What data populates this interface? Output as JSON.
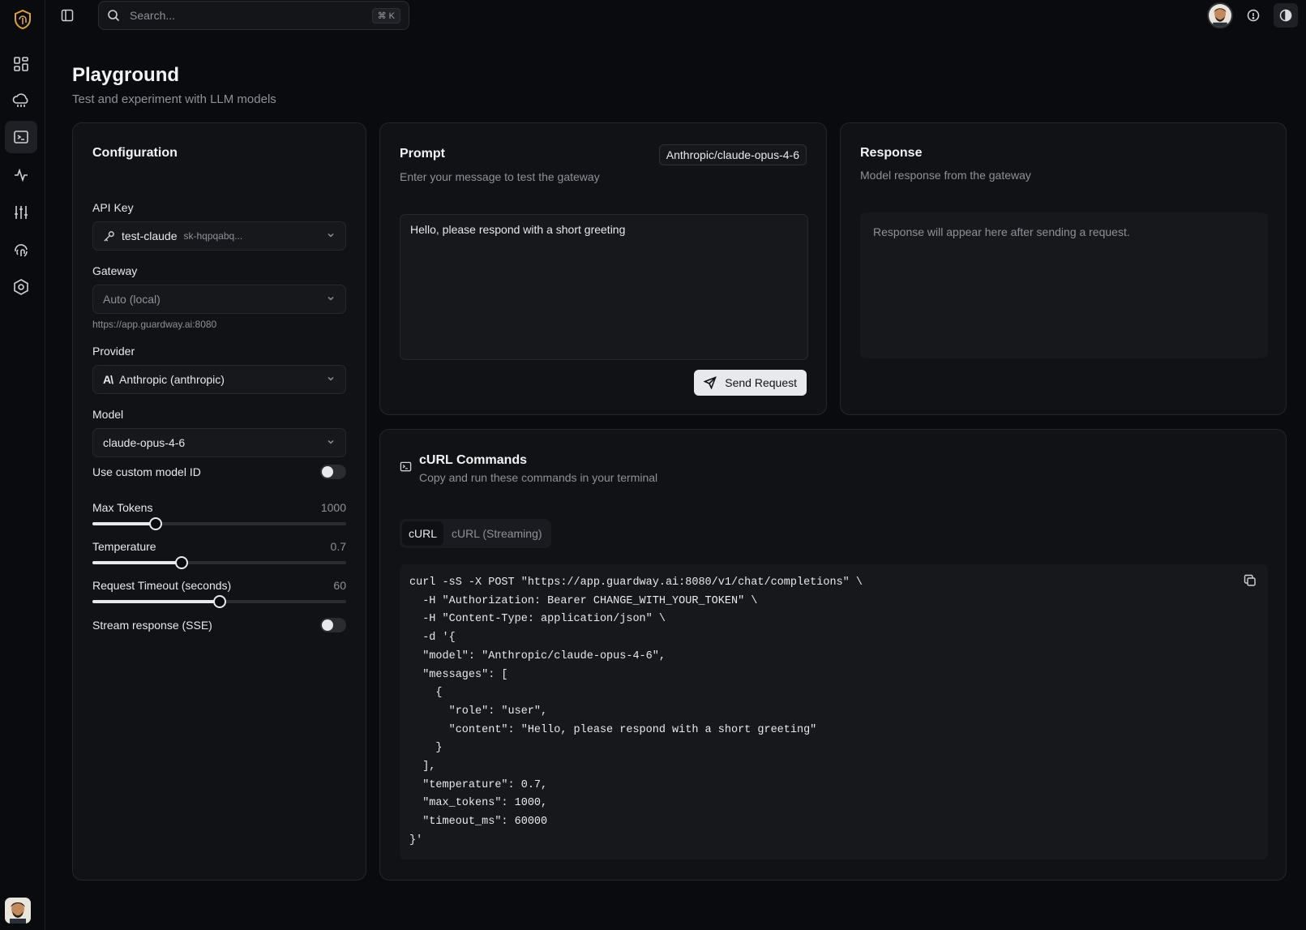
{
  "search": {
    "placeholder": "Search...",
    "shortcut": "⌘ K"
  },
  "nav": {
    "items": [
      {
        "name": "dashboard-icon",
        "active": false
      },
      {
        "name": "cloud-icon",
        "active": false
      },
      {
        "name": "terminal-icon",
        "active": true
      },
      {
        "name": "activity-icon",
        "active": false
      },
      {
        "name": "sliders-icon",
        "active": false
      },
      {
        "name": "fingerprint-icon",
        "active": false
      },
      {
        "name": "settings-hex-icon",
        "active": false
      }
    ]
  },
  "header": {
    "title": "Playground",
    "subtitle": "Test and experiment with LLM models"
  },
  "config": {
    "title": "Configuration",
    "api_key": {
      "label": "API Key",
      "value": "test-claude",
      "masked": "sk-hqpqabq..."
    },
    "gateway": {
      "label": "Gateway",
      "value": "Auto (local)",
      "hint": "https://app.guardway.ai:8080"
    },
    "provider": {
      "label": "Provider",
      "value": "Anthropic (anthropic)"
    },
    "model": {
      "label": "Model",
      "value": "claude-opus-4-6"
    },
    "custom_model": {
      "label": "Use custom model ID",
      "enabled": false
    },
    "max_tokens": {
      "label": "Max Tokens",
      "value": "1000",
      "fraction": 0.25
    },
    "temperature": {
      "label": "Temperature",
      "value": "0.7",
      "fraction": 0.35
    },
    "timeout": {
      "label": "Request Timeout (seconds)",
      "value": "60",
      "fraction": 0.5
    },
    "stream": {
      "label": "Stream response (SSE)",
      "enabled": false
    }
  },
  "prompt": {
    "title": "Prompt",
    "subtitle": "Enter your message to test the gateway",
    "model_badge": "Anthropic/claude-opus-4-6",
    "text": "Hello, please respond with a short greeting",
    "send_label": "Send Request"
  },
  "response": {
    "title": "Response",
    "subtitle": "Model response from the gateway",
    "placeholder": "Response will appear here after sending a request."
  },
  "curl": {
    "title": "cURL Commands",
    "subtitle": "Copy and run these commands in your terminal",
    "tabs": [
      "cURL",
      "cURL (Streaming)"
    ],
    "code": "curl -sS -X POST \"https://app.guardway.ai:8080/v1/chat/completions\" \\\n  -H \"Authorization: Bearer CHANGE_WITH_YOUR_TOKEN\" \\\n  -H \"Content-Type: application/json\" \\\n  -d '{\n  \"model\": \"Anthropic/claude-opus-4-6\",\n  \"messages\": [\n    {\n      \"role\": \"user\",\n      \"content\": \"Hello, please respond with a short greeting\"\n    }\n  ],\n  \"temperature\": 0.7,\n  \"max_tokens\": 1000,\n  \"timeout_ms\": 60000\n}'"
  },
  "colors": {
    "background": "#0a0b0e",
    "card": "#111215",
    "accent": "#e8e9ec",
    "logo": "#d9a441"
  }
}
